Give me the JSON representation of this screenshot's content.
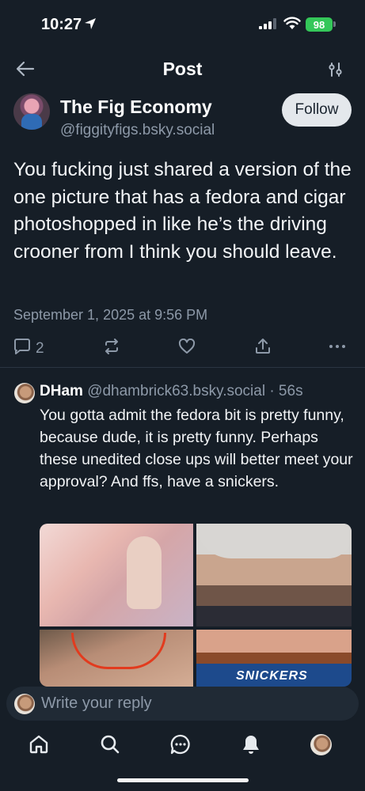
{
  "status_bar": {
    "time": "10:27",
    "battery": "98"
  },
  "header": {
    "title": "Post"
  },
  "post": {
    "display_name": "The Fig Economy",
    "handle": "@figgityfigs.bsky.social",
    "follow_label": "Follow",
    "text": "You fucking just shared a version of the one picture that has a fedora and cigar photoshopped in like he’s the driving crooner from I think you should leave.",
    "date": "September 1, 2025 at 9:56 PM",
    "reply_count": "2"
  },
  "reply": {
    "name": "DHam",
    "handle": "@dhambrick63.bsky.social",
    "age": "· 56s",
    "text": "You gotta admit the fedora bit is pretty funny, because dude, it is pretty funny. Perhaps these unedited close ups will better meet your approval? And ffs, have a snickers.",
    "image_text": "SNICKERS"
  },
  "composer": {
    "placeholder": "Write your reply"
  },
  "icons": {
    "back": "arrow-left-icon",
    "filter": "sliders-icon",
    "reply": "speech-bubble-icon",
    "repost": "repost-icon",
    "like": "heart-icon",
    "share": "share-icon",
    "more": "ellipsis-icon",
    "home": "home-icon",
    "search": "search-icon",
    "chat": "chat-icon",
    "notifications": "bell-icon"
  },
  "colors": {
    "background": "#161e27",
    "muted": "#8d99a8",
    "battery": "#34c759",
    "follow_bg": "#e4e8ec"
  }
}
